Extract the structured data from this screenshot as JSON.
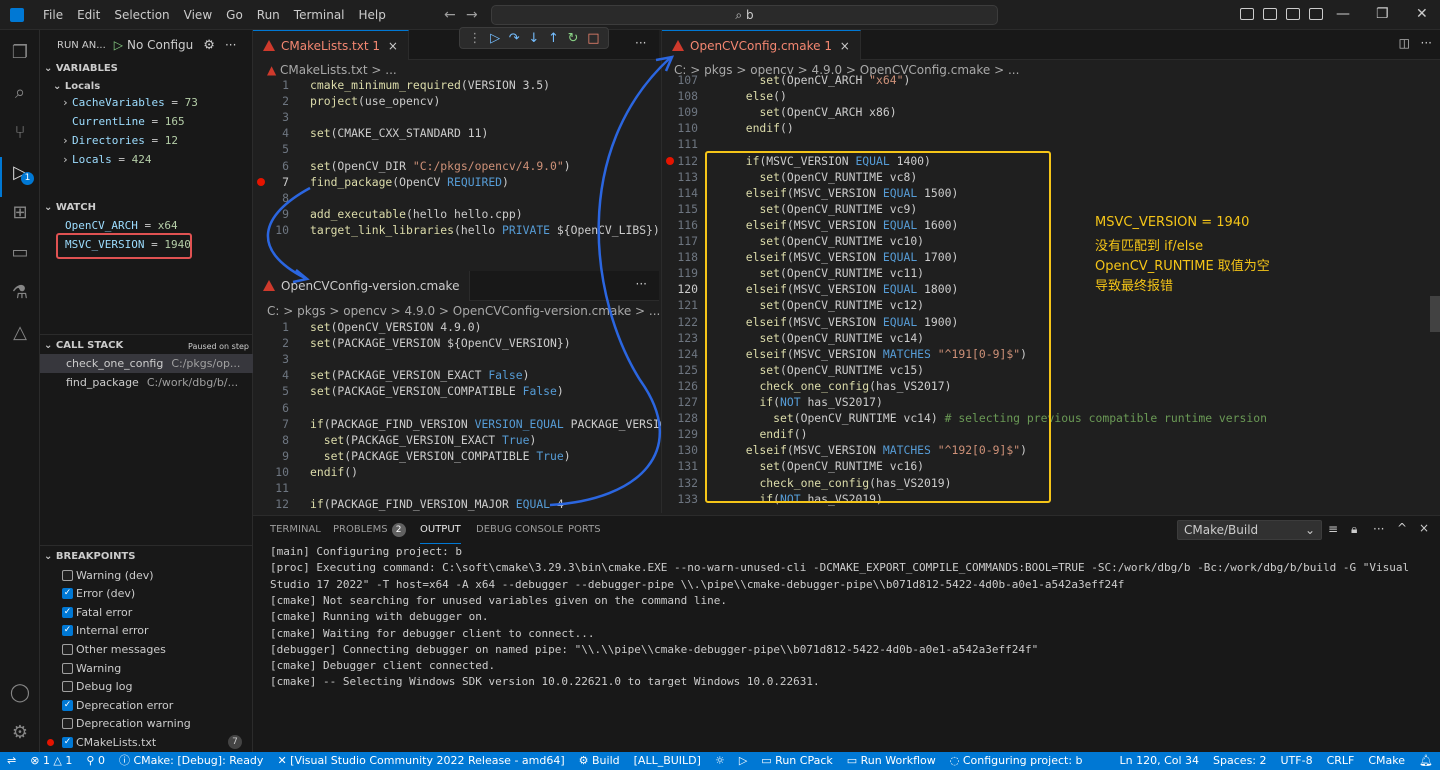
{
  "menu": [
    "File",
    "Edit",
    "Selection",
    "View",
    "Go",
    "Run",
    "Terminal",
    "Help"
  ],
  "command_center": "b",
  "sidebar": {
    "run_label": "RUN AN...",
    "config": "No Configu",
    "variables_title": "VARIABLES",
    "locals_title": "Locals",
    "variables": [
      {
        "name": "CacheVariables",
        "value": "73",
        "expandable": true
      },
      {
        "name": "CurrentLine",
        "value": "165",
        "expandable": false
      },
      {
        "name": "Directories",
        "value": "12",
        "expandable": true
      },
      {
        "name": "Locals",
        "value": "424",
        "expandable": true
      }
    ],
    "watch_title": "WATCH",
    "watch": [
      {
        "name": "OpenCV_ARCH",
        "value": "x64"
      },
      {
        "name": "MSVC_VERSION",
        "value": "1940"
      }
    ],
    "callstack_title": "CALL STACK",
    "callstack_status": "Paused on step",
    "callstack": [
      {
        "name": "check_one_config",
        "path": "C:/pkgs/op..."
      },
      {
        "name": "find_package",
        "path": "C:/work/dbg/b/..."
      }
    ],
    "breakpoints_title": "BREAKPOINTS",
    "breakpoints": [
      {
        "label": "Warning (dev)",
        "checked": false
      },
      {
        "label": "Error (dev)",
        "checked": true
      },
      {
        "label": "Fatal error",
        "checked": true
      },
      {
        "label": "Internal error",
        "checked": true
      },
      {
        "label": "Other messages",
        "checked": false
      },
      {
        "label": "Warning",
        "checked": false
      },
      {
        "label": "Debug log",
        "checked": false
      },
      {
        "label": "Deprecation error",
        "checked": true
      },
      {
        "label": "Deprecation warning",
        "checked": false
      },
      {
        "label": "CMakeLists.txt",
        "checked": true,
        "count": "7"
      }
    ]
  },
  "editor_left": {
    "tab": "CMakeLists.txt",
    "tab_badge": "1",
    "crumb": "CMakeLists.txt > ...",
    "lines": [
      {
        "n": "1",
        "code": [
          [
            "fn",
            "cmake_minimum_required"
          ],
          [
            "txt",
            "(VERSION 3.5)"
          ]
        ]
      },
      {
        "n": "2",
        "code": [
          [
            "fn",
            "project"
          ],
          [
            "txt",
            "(use_opencv)"
          ]
        ]
      },
      {
        "n": "3",
        "code": []
      },
      {
        "n": "4",
        "code": [
          [
            "fn",
            "set"
          ],
          [
            "txt",
            "(CMAKE_CXX_STANDARD 11)"
          ]
        ]
      },
      {
        "n": "5",
        "code": []
      },
      {
        "n": "6",
        "code": [
          [
            "fn",
            "set"
          ],
          [
            "txt",
            "(OpenCV_DIR "
          ],
          [
            "str",
            "\"C:/pkgs/opencv/4.9.0\""
          ],
          [
            "txt",
            ")"
          ]
        ]
      },
      {
        "n": "7",
        "code": [
          [
            "fn",
            "find_package"
          ],
          [
            "txt",
            "(OpenCV "
          ],
          [
            "kw",
            "REQUIRED"
          ],
          [
            "txt",
            ")"
          ]
        ]
      },
      {
        "n": "8",
        "code": []
      },
      {
        "n": "9",
        "code": [
          [
            "fn",
            "add_executable"
          ],
          [
            "txt",
            "(hello hello.cpp)"
          ]
        ]
      },
      {
        "n": "10",
        "code": [
          [
            "fn",
            "target_link_libraries"
          ],
          [
            "txt",
            "(hello "
          ],
          [
            "kw",
            "PRIVATE"
          ],
          [
            "txt",
            " ${OpenCV_LIBS})"
          ]
        ]
      }
    ]
  },
  "editor_left2": {
    "tab": "OpenCVConfig-version.cmake",
    "crumb": "C: > pkgs > opencv > 4.9.0 > OpenCVConfig-version.cmake > ...",
    "lines": [
      {
        "n": "1",
        "code": [
          [
            "fn",
            "set"
          ],
          [
            "txt",
            "(OpenCV_VERSION 4.9.0)"
          ]
        ]
      },
      {
        "n": "2",
        "code": [
          [
            "fn",
            "set"
          ],
          [
            "txt",
            "(PACKAGE_VERSION ${OpenCV_VERSION})"
          ]
        ]
      },
      {
        "n": "3",
        "code": []
      },
      {
        "n": "4",
        "code": [
          [
            "fn",
            "set"
          ],
          [
            "txt",
            "(PACKAGE_VERSION_EXACT "
          ],
          [
            "kw",
            "False"
          ],
          [
            "txt",
            ")"
          ]
        ]
      },
      {
        "n": "5",
        "code": [
          [
            "fn",
            "set"
          ],
          [
            "txt",
            "(PACKAGE_VERSION_COMPATIBLE "
          ],
          [
            "kw",
            "False"
          ],
          [
            "txt",
            ")"
          ]
        ]
      },
      {
        "n": "6",
        "code": []
      },
      {
        "n": "7",
        "code": [
          [
            "fn",
            "if"
          ],
          [
            "txt",
            "(PACKAGE_FIND_VERSION "
          ],
          [
            "kw",
            "VERSION_EQUAL"
          ],
          [
            "txt",
            " PACKAGE_VERSION)"
          ]
        ]
      },
      {
        "n": "8",
        "code": [
          [
            "txt",
            "  "
          ],
          [
            "fn",
            "set"
          ],
          [
            "txt",
            "(PACKAGE_VERSION_EXACT "
          ],
          [
            "kw",
            "True"
          ],
          [
            "txt",
            ")"
          ]
        ]
      },
      {
        "n": "9",
        "code": [
          [
            "txt",
            "  "
          ],
          [
            "fn",
            "set"
          ],
          [
            "txt",
            "(PACKAGE_VERSION_COMPATIBLE "
          ],
          [
            "kw",
            "True"
          ],
          [
            "txt",
            ")"
          ]
        ]
      },
      {
        "n": "10",
        "code": [
          [
            "fn",
            "endif"
          ],
          [
            "txt",
            "()"
          ]
        ]
      },
      {
        "n": "11",
        "code": []
      },
      {
        "n": "12",
        "code": [
          [
            "fn",
            "if"
          ],
          [
            "txt",
            "(PACKAGE_FIND_VERSION_MAJOR "
          ],
          [
            "kw",
            "EQUAL"
          ],
          [
            "txt",
            " 4"
          ]
        ]
      }
    ]
  },
  "editor_right": {
    "tab": "OpenCVConfig.cmake",
    "tab_badge": "1",
    "crumb": "C: > pkgs > opencv > 4.9.0 > OpenCVConfig.cmake > ...",
    "lines": [
      {
        "n": "107",
        "code": [
          [
            "txt",
            "    "
          ],
          [
            "fn",
            "set"
          ],
          [
            "txt",
            "(OpenCV_ARCH "
          ],
          [
            "str",
            "\"x64\""
          ],
          [
            "txt",
            ")"
          ]
        ]
      },
      {
        "n": "108",
        "code": [
          [
            "txt",
            "  "
          ],
          [
            "fn",
            "else"
          ],
          [
            "txt",
            "()"
          ]
        ]
      },
      {
        "n": "109",
        "code": [
          [
            "txt",
            "    "
          ],
          [
            "fn",
            "set"
          ],
          [
            "txt",
            "(OpenCV_ARCH x86)"
          ]
        ]
      },
      {
        "n": "110",
        "code": [
          [
            "txt",
            "  "
          ],
          [
            "fn",
            "endif"
          ],
          [
            "txt",
            "()"
          ]
        ]
      },
      {
        "n": "111",
        "code": []
      },
      {
        "n": "112",
        "code": [
          [
            "txt",
            "  "
          ],
          [
            "fn",
            "if"
          ],
          [
            "txt",
            "(MSVC_VERSION "
          ],
          [
            "kw",
            "EQUAL"
          ],
          [
            "txt",
            " 1400)"
          ]
        ]
      },
      {
        "n": "113",
        "code": [
          [
            "txt",
            "    "
          ],
          [
            "fn",
            "set"
          ],
          [
            "txt",
            "(OpenCV_RUNTIME vc8)"
          ]
        ]
      },
      {
        "n": "114",
        "code": [
          [
            "txt",
            "  "
          ],
          [
            "fn",
            "elseif"
          ],
          [
            "txt",
            "(MSVC_VERSION "
          ],
          [
            "kw",
            "EQUAL"
          ],
          [
            "txt",
            " 1500)"
          ]
        ]
      },
      {
        "n": "115",
        "code": [
          [
            "txt",
            "    "
          ],
          [
            "fn",
            "set"
          ],
          [
            "txt",
            "(OpenCV_RUNTIME vc9)"
          ]
        ]
      },
      {
        "n": "116",
        "code": [
          [
            "txt",
            "  "
          ],
          [
            "fn",
            "elseif"
          ],
          [
            "txt",
            "(MSVC_VERSION "
          ],
          [
            "kw",
            "EQUAL"
          ],
          [
            "txt",
            " 1600)"
          ]
        ]
      },
      {
        "n": "117",
        "code": [
          [
            "txt",
            "    "
          ],
          [
            "fn",
            "set"
          ],
          [
            "txt",
            "(OpenCV_RUNTIME vc10)"
          ]
        ]
      },
      {
        "n": "118",
        "code": [
          [
            "txt",
            "  "
          ],
          [
            "fn",
            "elseif"
          ],
          [
            "txt",
            "(MSVC_VERSION "
          ],
          [
            "kw",
            "EQUAL"
          ],
          [
            "txt",
            " 1700)"
          ]
        ]
      },
      {
        "n": "119",
        "code": [
          [
            "txt",
            "    "
          ],
          [
            "fn",
            "set"
          ],
          [
            "txt",
            "(OpenCV_RUNTIME vc11)"
          ]
        ]
      },
      {
        "n": "120",
        "code": [
          [
            "txt",
            "  "
          ],
          [
            "fn",
            "elseif"
          ],
          [
            "txt",
            "(MSVC_VERSION "
          ],
          [
            "kw",
            "EQUAL"
          ],
          [
            "txt",
            " 1800)"
          ]
        ]
      },
      {
        "n": "121",
        "code": [
          [
            "txt",
            "    "
          ],
          [
            "fn",
            "set"
          ],
          [
            "txt",
            "(OpenCV_RUNTIME vc12)"
          ]
        ]
      },
      {
        "n": "122",
        "code": [
          [
            "txt",
            "  "
          ],
          [
            "fn",
            "elseif"
          ],
          [
            "txt",
            "(MSVC_VERSION "
          ],
          [
            "kw",
            "EQUAL"
          ],
          [
            "txt",
            " 1900)"
          ]
        ]
      },
      {
        "n": "123",
        "code": [
          [
            "txt",
            "    "
          ],
          [
            "fn",
            "set"
          ],
          [
            "txt",
            "(OpenCV_RUNTIME vc14)"
          ]
        ]
      },
      {
        "n": "124",
        "code": [
          [
            "txt",
            "  "
          ],
          [
            "fn",
            "elseif"
          ],
          [
            "txt",
            "(MSVC_VERSION "
          ],
          [
            "kw",
            "MATCHES"
          ],
          [
            "txt",
            " "
          ],
          [
            "str",
            "\"^191[0-9]$\""
          ],
          [
            "txt",
            ")"
          ]
        ]
      },
      {
        "n": "125",
        "code": [
          [
            "txt",
            "    "
          ],
          [
            "fn",
            "set"
          ],
          [
            "txt",
            "(OpenCV_RUNTIME vc15)"
          ]
        ]
      },
      {
        "n": "126",
        "code": [
          [
            "txt",
            "    "
          ],
          [
            "fn",
            "check_one_config"
          ],
          [
            "txt",
            "(has_VS2017)"
          ]
        ]
      },
      {
        "n": "127",
        "code": [
          [
            "txt",
            "    "
          ],
          [
            "fn",
            "if"
          ],
          [
            "txt",
            "("
          ],
          [
            "kw",
            "NOT"
          ],
          [
            "txt",
            " has_VS2017)"
          ]
        ]
      },
      {
        "n": "128",
        "code": [
          [
            "txt",
            "      "
          ],
          [
            "fn",
            "set"
          ],
          [
            "txt",
            "(OpenCV_RUNTIME vc14) "
          ],
          [
            "cmt",
            "# selecting previous compatible runtime version"
          ]
        ]
      },
      {
        "n": "129",
        "code": [
          [
            "txt",
            "    "
          ],
          [
            "fn",
            "endif"
          ],
          [
            "txt",
            "()"
          ]
        ]
      },
      {
        "n": "130",
        "code": [
          [
            "txt",
            "  "
          ],
          [
            "fn",
            "elseif"
          ],
          [
            "txt",
            "(MSVC_VERSION "
          ],
          [
            "kw",
            "MATCHES"
          ],
          [
            "txt",
            " "
          ],
          [
            "str",
            "\"^192[0-9]$\""
          ],
          [
            "txt",
            ")"
          ]
        ]
      },
      {
        "n": "131",
        "code": [
          [
            "txt",
            "    "
          ],
          [
            "fn",
            "set"
          ],
          [
            "txt",
            "(OpenCV_RUNTIME vc16)"
          ]
        ]
      },
      {
        "n": "132",
        "code": [
          [
            "txt",
            "    "
          ],
          [
            "fn",
            "check_one_config"
          ],
          [
            "txt",
            "(has_VS2019)"
          ]
        ]
      },
      {
        "n": "133",
        "code": [
          [
            "txt",
            "    "
          ],
          [
            "fn",
            "if"
          ],
          [
            "txt",
            "("
          ],
          [
            "kw",
            "NOT"
          ],
          [
            "txt",
            " has_VS2019)"
          ]
        ]
      }
    ]
  },
  "annotation": [
    "MSVC_VERSION = 1940",
    "没有匹配到 if/else",
    "OpenCV_RUNTIME 取值为空",
    "导致最终报错"
  ],
  "panel": {
    "tabs": [
      "TERMINAL",
      "PROBLEMS",
      "OUTPUT",
      "DEBUG CONSOLE",
      "PORTS"
    ],
    "problems_count": "2",
    "output_select": "CMake/Build",
    "output": [
      "[main] Configuring project: b",
      "[proc] Executing command: C:\\soft\\cmake\\3.29.3\\bin\\cmake.EXE --no-warn-unused-cli -DCMAKE_EXPORT_COMPILE_COMMANDS:BOOL=TRUE -SC:/work/dbg/b -Bc:/work/dbg/b/build -G \"Visual",
      "Studio 17 2022\" -T host=x64 -A x64 --debugger --debugger-pipe \\\\.\\pipe\\\\cmake-debugger-pipe\\\\b071d812-5422-4d0b-a0e1-a542a3eff24f",
      "[cmake] Not searching for unused variables given on the command line.",
      "[cmake] Running with debugger on.",
      "[cmake] Waiting for debugger client to connect...",
      "[debugger] Connecting debugger on named pipe: \"\\\\.\\\\pipe\\\\cmake-debugger-pipe\\\\b071d812-5422-4d0b-a0e1-a542a3eff24f\"",
      "[cmake] Debugger client connected.",
      "[cmake] -- Selecting Windows SDK version 10.0.22621.0 to target Windows 10.0.22631."
    ]
  },
  "status": {
    "errors": "1",
    "warnings": "1",
    "ports": "0",
    "cmake": "CMake: [Debug]: Ready",
    "kit": "[Visual Studio Community 2022 Release - amd64]",
    "build": "Build",
    "target": "[ALL_BUILD]",
    "cpack": "Run CPack",
    "workflow": "Run Workflow",
    "configuring": "Configuring project: b",
    "cursor": "Ln 120, Col 34",
    "spaces": "Spaces: 2",
    "encoding": "UTF-8",
    "eol": "CRLF",
    "language": "CMake"
  }
}
